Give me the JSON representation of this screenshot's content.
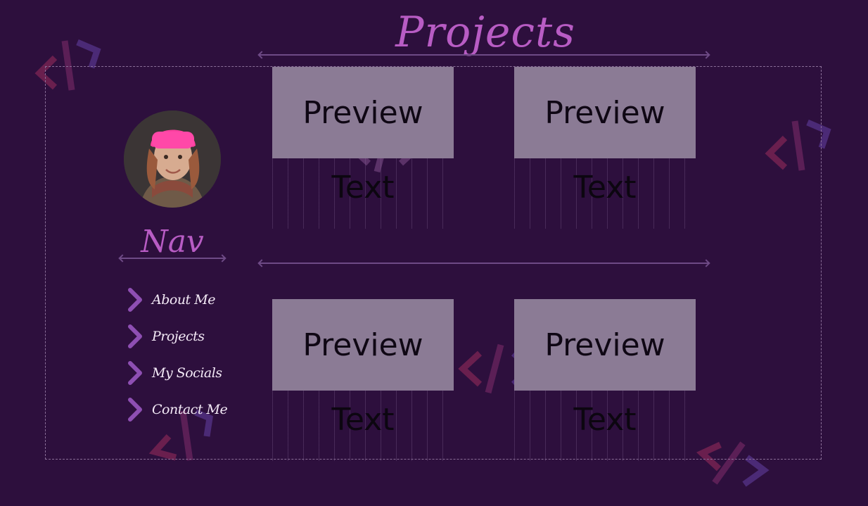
{
  "header": {
    "title": "Projects"
  },
  "nav": {
    "title": "Nav",
    "items": [
      {
        "label": "About Me"
      },
      {
        "label": "Projects"
      },
      {
        "label": "My Socials"
      },
      {
        "label": "Contact Me"
      }
    ]
  },
  "cards": [
    {
      "preview": "Preview",
      "text": "Text"
    },
    {
      "preview": "Preview",
      "text": "Text"
    },
    {
      "preview": "Preview",
      "text": "Text"
    },
    {
      "preview": "Preview",
      "text": "Text"
    }
  ],
  "colors": {
    "background": "#2d0f3d",
    "accent": "#b85cc4",
    "card": "#8b7b95",
    "chevron": "#8e4fb3"
  }
}
